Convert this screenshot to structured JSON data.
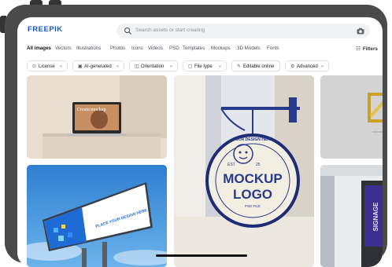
{
  "header": {
    "logo": "FREEPIK",
    "search_placeholder": "Search assets or start creating",
    "filters_label": "Filters"
  },
  "categories": [
    {
      "label": "All images",
      "active": true
    },
    {
      "label": "Vectors",
      "active": false
    },
    {
      "label": "Illustrations",
      "active": false
    },
    {
      "label": "Photos",
      "active": false
    },
    {
      "label": "Icons",
      "active": false
    },
    {
      "label": "Videos",
      "active": false
    },
    {
      "label": "PSD",
      "active": false
    },
    {
      "label": "Templates",
      "active": false
    },
    {
      "label": "Mockups",
      "active": false
    },
    {
      "label": "3D Models",
      "active": false
    },
    {
      "label": "Fonts",
      "active": false
    }
  ],
  "chips": [
    {
      "label": "License",
      "icon": "license-icon"
    },
    {
      "label": "AI-generated",
      "icon": "ai-icon"
    },
    {
      "label": "Orientation",
      "icon": "orientation-icon"
    },
    {
      "label": "File type",
      "icon": "file-icon"
    },
    {
      "label": "Editable online",
      "icon": "edit-icon"
    },
    {
      "label": "Advanced",
      "icon": "gear-icon"
    }
  ],
  "tiles": {
    "laptop": {
      "screen_text": "Create/mockup"
    },
    "sign": {
      "top_text": "YOUR DESIGN HERE",
      "est": "EST",
      "year": "25",
      "title_1": "MOCKUP",
      "title_2": "LOGO",
      "sub": "PSD FILE"
    },
    "billboard": {
      "text": "PLACE YOUR DESIGN HERE"
    },
    "signage": {
      "text": "SIGNAGE"
    }
  },
  "colors": {
    "brand": "#1a55c8",
    "sign_blue": "#283a8c",
    "sign_cream": "#f3eee2"
  }
}
